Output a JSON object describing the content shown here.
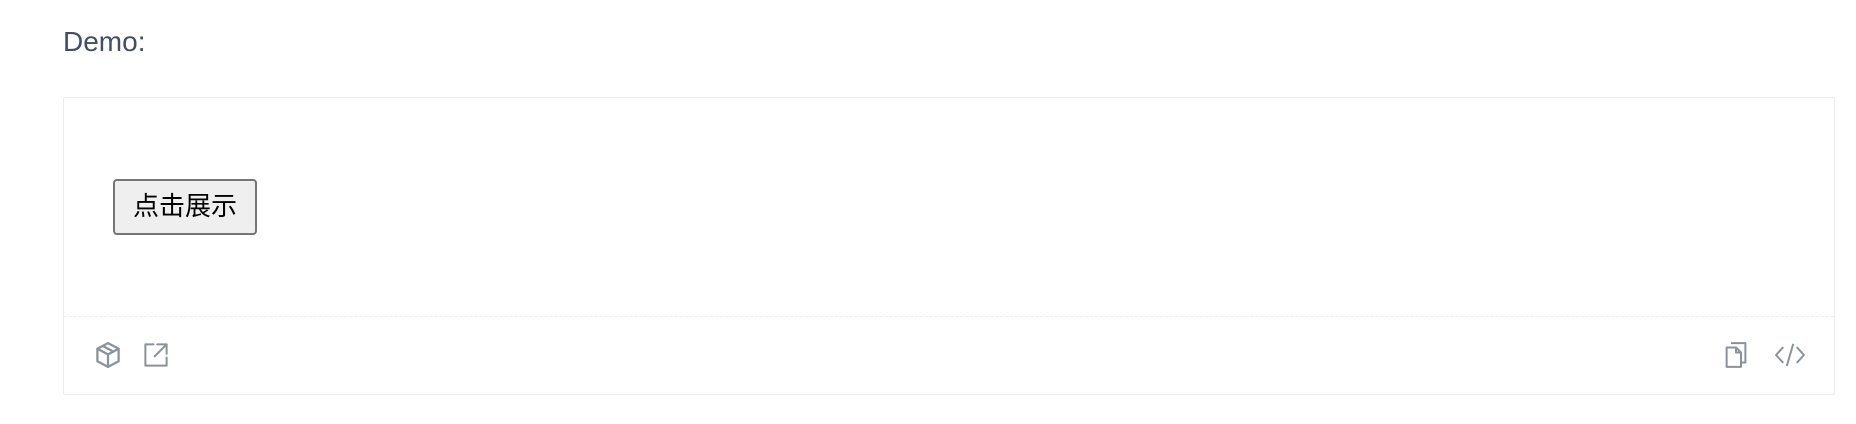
{
  "heading": "Demo:",
  "demo": {
    "button_label": "点击展示"
  },
  "actions": {
    "left": [
      {
        "icon": "codesandbox-icon"
      },
      {
        "icon": "external-link-icon"
      }
    ],
    "right": [
      {
        "icon": "copy-icon"
      },
      {
        "icon": "code-icon"
      }
    ]
  },
  "colors": {
    "text": "#454d64",
    "border": "#ebedf1",
    "icon": "#8a919f"
  }
}
